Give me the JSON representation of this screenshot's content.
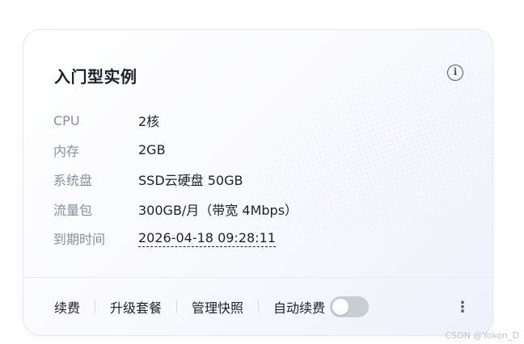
{
  "card": {
    "title": "入门型实例",
    "info_icon": "info-circle-icon"
  },
  "specs": [
    {
      "label": "CPU",
      "value": "2核"
    },
    {
      "label": "内存",
      "value": "2GB"
    },
    {
      "label": "系统盘",
      "value": "SSD云硬盘 50GB"
    },
    {
      "label": "流量包",
      "value": "300GB/月（带宽 4Mbps）"
    },
    {
      "label": "到期时间",
      "value": "2026-04-18 09:28:11"
    }
  ],
  "footer": {
    "renew": "续费",
    "upgrade": "升级套餐",
    "snapshot": "管理快照",
    "auto_renew": "自动续费",
    "auto_renew_enabled": false,
    "more_icon": "more-vertical-icon"
  },
  "watermark": "CSDN @Yokon_D",
  "colors": {
    "primary_text": "#1d2129",
    "secondary_text": "#86909c",
    "toggle_off": "#c9cdd4"
  }
}
